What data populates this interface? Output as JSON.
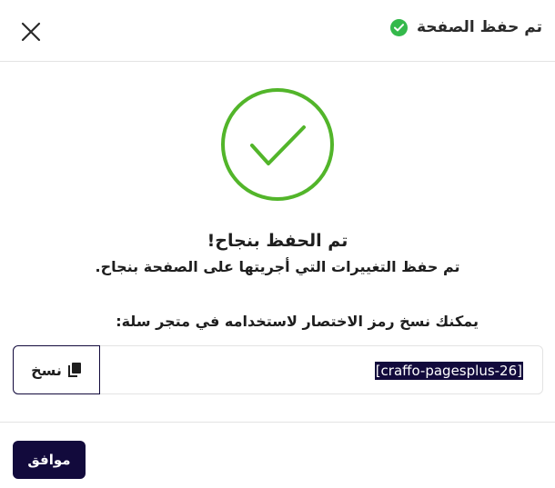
{
  "header": {
    "title": "تم حفظ الصفحة",
    "status_color": "#34b94b",
    "close_icon": "close-icon"
  },
  "success": {
    "icon": "checkmark-circle-icon",
    "icon_color": "#52b52a",
    "title": "تم الحفظ بنجاح!",
    "message": "تم حفظ التغييرات التي أجريتها على الصفحة بنجاح."
  },
  "shortcode": {
    "label": "يمكنك نسخ رمز الاختصار لاستخدامه في متجر سلة:",
    "value": "[craffo-pagesplus-26]",
    "copy_label": "نسخ",
    "copy_icon": "copy-icon"
  },
  "footer": {
    "ok_label": "موافق",
    "accent_color": "#120a3c"
  }
}
